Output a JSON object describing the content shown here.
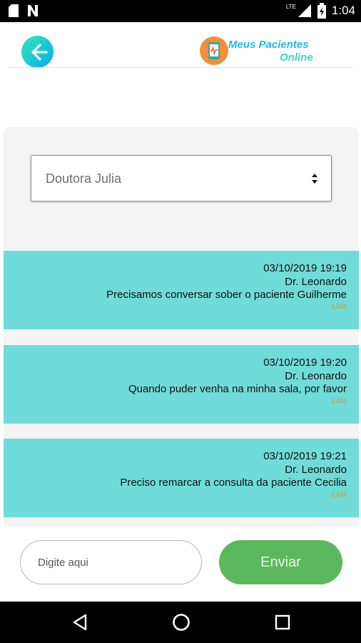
{
  "status_bar": {
    "time": "1:04",
    "network_label": "LTE",
    "icons": [
      "sd-card-icon",
      "notification-n-icon",
      "signal-icon",
      "battery-icon"
    ]
  },
  "header": {
    "back_icon": "arrow-left-icon",
    "logo_line1": "Meus Pacientes",
    "logo_line2": "Online",
    "logo_icon": "phone-heartbeat-icon"
  },
  "recipient_select": {
    "selected": "Doutora Julia",
    "icon": "sort-arrows-icon"
  },
  "messages": [
    {
      "datetime": "03/10/2019 19:19",
      "sender": "Dr. Leonardo",
      "text": "Precisamos conversar sober o paciente Guilherme",
      "status": "Lida"
    },
    {
      "datetime": "03/10/2019 19:20",
      "sender": "Dr. Leonardo",
      "text": "Quando puder venha na minha sala, por favor",
      "status": "Lida"
    },
    {
      "datetime": "03/10/2019 19:21",
      "sender": "Dr. Leonardo",
      "text": "Preciso remarcar a consulta da paciente Cecilia",
      "status": "Lida"
    }
  ],
  "composer": {
    "placeholder": "Digite aqui",
    "value": "",
    "send_label": "Enviar"
  },
  "nav_bar": {
    "icons": [
      "back-triangle-icon",
      "home-circle-icon",
      "recents-square-icon"
    ]
  },
  "colors": {
    "message_bg": "#6fdcd9",
    "send_button": "#5cb85c",
    "status_text": "#d79a2c",
    "logo_blue": "#27b6e6",
    "logo_teal": "#3ed3c3",
    "logo_orange": "#f0913a"
  }
}
